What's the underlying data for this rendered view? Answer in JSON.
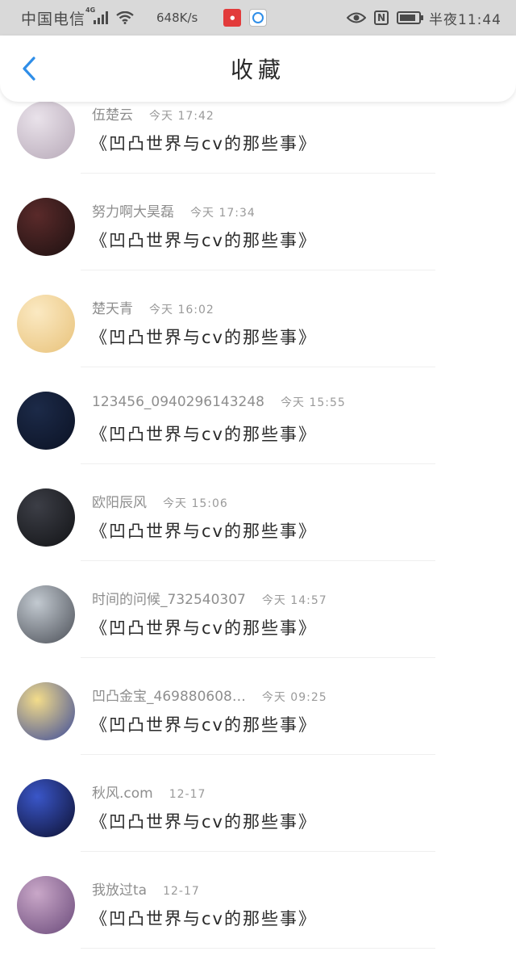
{
  "status_bar": {
    "carrier": "中国电信",
    "network": "4G",
    "speed": "648K/s",
    "time": "半夜11:44",
    "icons": [
      "signal-icon",
      "wifi-icon",
      "app-notification-icon",
      "app-circle-icon",
      "eye-icon",
      "nfc-icon",
      "battery-icon"
    ],
    "battery_level": 0.85
  },
  "header": {
    "back_icon": "chevron-left-icon",
    "title": "收藏",
    "accent": "#2f8ee8"
  },
  "items": [
    {
      "name": "伍楚云",
      "time": "今天 17:42",
      "work": "《凹凸世界与cv的那些事》",
      "avatar_colors": [
        "#e9e2ea",
        "#b7a9b8"
      ]
    },
    {
      "name": "努力啊大昊磊",
      "time": "今天 17:34",
      "work": "《凹凸世界与cv的那些事》",
      "avatar_colors": [
        "#5a2a2a",
        "#1d1111"
      ]
    },
    {
      "name": "楚天青",
      "time": "今天 16:02",
      "work": "《凹凸世界与cv的那些事》",
      "avatar_colors": [
        "#fbe9c2",
        "#e8c27a"
      ]
    },
    {
      "name": "123456_0940296143248",
      "time": "今天 15:55",
      "work": "《凹凸世界与cv的那些事》",
      "avatar_colors": [
        "#1c2a48",
        "#0b1224"
      ]
    },
    {
      "name": "欧阳辰风",
      "time": "今天 15:06",
      "work": "《凹凸世界与cv的那些事》",
      "avatar_colors": [
        "#3c3e46",
        "#121316"
      ]
    },
    {
      "name": "时间的问候_732540307",
      "time": "今天 14:57",
      "work": "《凹凸世界与cv的那些事》",
      "avatar_colors": [
        "#c2c9d0",
        "#4b4f57"
      ]
    },
    {
      "name": "凹凸金宝_469880608…",
      "time": "今天 09:25",
      "work": "《凹凸世界与cv的那些事》",
      "avatar_colors": [
        "#f3dc8a",
        "#3b4a9a"
      ]
    },
    {
      "name": "秋风.com",
      "time": "12-17",
      "work": "《凹凸世界与cv的那些事》",
      "avatar_colors": [
        "#3a56c8",
        "#0d1030"
      ]
    },
    {
      "name": "我放过ta",
      "time": "12-17",
      "work": "《凹凸世界与cv的那些事》",
      "avatar_colors": [
        "#c9a7c8",
        "#6a4a7a"
      ]
    }
  ]
}
